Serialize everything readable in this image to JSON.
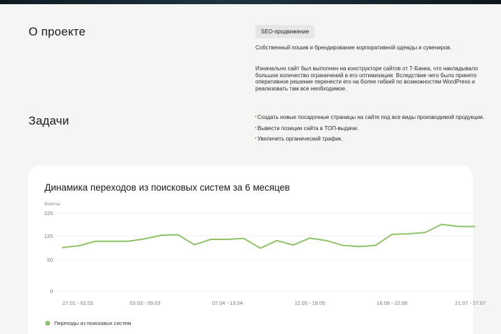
{
  "about": {
    "title": "О проекте",
    "tag": "SEO-продвижение",
    "paragraph1": "Собственный пошив и брендирование корпоративной одежды и сувениров.",
    "paragraph2": "Изначально сайт был выполнен на конструкторе сайтов от Т-Банка, что накладывало большое количество ограничений в его оптимизации. Вследствие чего было принято оперативное решение перенести его на более гибкий по возможностям WordPress и реализовать там все необходимое."
  },
  "tasks": {
    "title": "Задачи",
    "bullet": "•",
    "items": [
      "Создать новые посадочные страницы на сайте под все виды производимой продукции.",
      "Вывести позиции сайта в ТОП-выдачи.",
      "Увеличить органический трафик."
    ]
  },
  "chart_data": {
    "type": "line",
    "title": "Динамика переходов из поисковых систем за 6 месяцев",
    "ylabel": "Визиты",
    "ylim": [
      0,
      225
    ],
    "yticks": [
      0,
      50,
      125,
      225
    ],
    "grid": true,
    "legend_position": "bottom-left",
    "xtick_labels": [
      "27.01 - 02.02",
      "03.03 - 09.03",
      "07.04 - 13.04",
      "12.05 - 18.05",
      "16.06 - 22.06",
      "21.07 - 27.07"
    ],
    "xtick_indices": [
      0,
      5,
      10,
      15,
      20,
      25
    ],
    "color": "#8dc365",
    "series": [
      {
        "name": "Переходы из поисковых систем",
        "values": [
          88,
          94,
          108,
          108,
          108,
          116,
          128,
          130,
          97,
          114,
          114,
          117,
          86,
          110,
          96,
          118,
          110,
          95,
          91,
          95,
          132,
          134,
          140,
          175,
          166,
          166
        ]
      }
    ]
  }
}
